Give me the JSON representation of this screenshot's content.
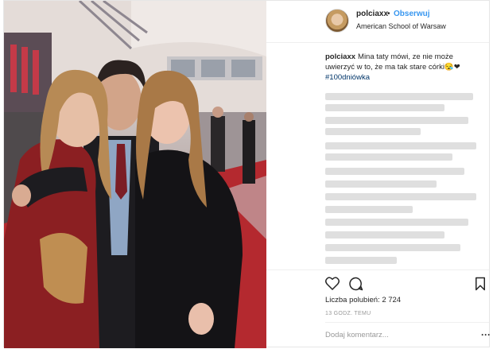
{
  "post": {
    "photo_icon": "group-photo",
    "username": "polciaxx",
    "separator": "•",
    "follow_label": "Obserwuj",
    "location": "American School of Warsaw",
    "caption_username": "polciaxx",
    "caption_text": "Mina taty mówi, ze nie może uwierzyć w to, że ma tak stare córki😪❤",
    "caption_hashtag": "#100dniówka",
    "likes_label": "Liczba polubień:",
    "likes_count": "2 724",
    "timestamp": "13 GODZ. TEMU",
    "comment_placeholder": "Dodaj komentarz...",
    "more_label": "···"
  },
  "colors": {
    "follow": "#3897f0",
    "hashtag": "#003569",
    "carpet": "#b4292f"
  },
  "icons": [
    "heart-icon",
    "comment-icon",
    "bookmark-icon",
    "more-options-icon"
  ]
}
